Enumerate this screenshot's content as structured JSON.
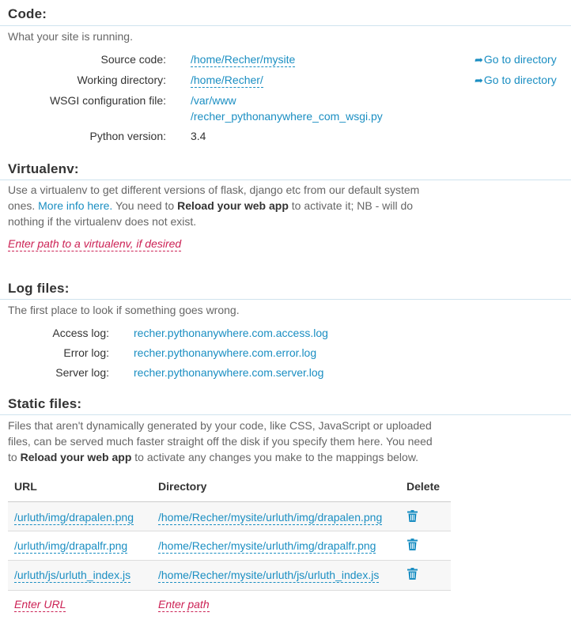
{
  "code": {
    "title": "Code:",
    "description": "What your site is running.",
    "source_label": "Source code:",
    "source_value": "/home/Recher/mysite",
    "workdir_label": "Working directory:",
    "workdir_value": "/home/Recher/",
    "goto_label": "Go to directory",
    "wsgi_label": "WSGI configuration file:",
    "wsgi_line1": "/var/www",
    "wsgi_line2": "/recher_pythonanywhere_com_wsgi.py",
    "python_label": "Python version:",
    "python_value": "3.4"
  },
  "virtualenv": {
    "title": "Virtualenv:",
    "desc_line1": "Use a virtualenv to get different versions of flask, django etc from our default system",
    "desc_part1": "ones. ",
    "more_info": "More info here.",
    "desc_part2": " You need to ",
    "reload": "Reload your web app",
    "desc_part3": " to activate it; NB - will do",
    "desc_line3": "nothing if the virtualenv does not exist.",
    "placeholder": "Enter path to a virtualenv, if desired"
  },
  "logs": {
    "title": "Log files:",
    "description": "The first place to look if something goes wrong.",
    "access_label": "Access log:",
    "access_value": "recher.pythonanywhere.com.access.log",
    "error_label": "Error log:",
    "error_value": "recher.pythonanywhere.com.error.log",
    "server_label": "Server log:",
    "server_value": "recher.pythonanywhere.com.server.log"
  },
  "static": {
    "title": "Static files:",
    "desc_line1": "Files that aren't dynamically generated by your code, like CSS, JavaScript or uploaded",
    "desc_line2": "files, can be served much faster straight off the disk if you specify them here. You need",
    "desc_part1": "to ",
    "reload": "Reload your web app",
    "desc_part2": " to activate any changes you make to the mappings below.",
    "col_url": "URL",
    "col_dir": "Directory",
    "col_delete": "Delete",
    "rows": [
      {
        "url": "/urluth/img/drapalen.png",
        "dir": "/home/Recher/mysite/urluth/img/drapalen.png"
      },
      {
        "url": "/urluth/img/drapalfr.png",
        "dir": "/home/Recher/mysite/urluth/img/drapalfr.png"
      },
      {
        "url": "/urluth/js/urluth_index.js",
        "dir": "/home/Recher/mysite/urluth/js/urluth_index.js"
      }
    ],
    "enter_url": "Enter URL",
    "enter_path": "Enter path"
  },
  "colors": {
    "link": "#1a8ec2",
    "placeholder": "#cc2255",
    "rule": "#cfe3ee"
  },
  "icons": {
    "goto": "share-arrow-icon",
    "delete": "trash-icon"
  }
}
